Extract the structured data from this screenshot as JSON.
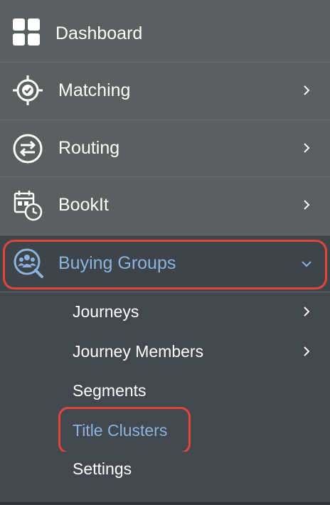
{
  "nav": {
    "items": [
      {
        "label": "Dashboard",
        "icon": "dashboard-grid-icon",
        "has_chevron": false
      },
      {
        "label": "Matching",
        "icon": "target-check-icon",
        "has_chevron": true
      },
      {
        "label": "Routing",
        "icon": "routing-arrows-icon",
        "has_chevron": true
      },
      {
        "label": "BookIt",
        "icon": "calendar-clock-icon",
        "has_chevron": true
      },
      {
        "label": "Buying Groups",
        "icon": "people-search-icon",
        "expanded": true
      }
    ],
    "buying_groups_children": [
      {
        "label": "Journeys",
        "has_chevron": true
      },
      {
        "label": "Journey Members",
        "has_chevron": true
      },
      {
        "label": "Segments",
        "has_chevron": false
      },
      {
        "label": "Title Clusters",
        "has_chevron": false,
        "active": true
      },
      {
        "label": "Settings",
        "has_chevron": false
      }
    ]
  },
  "colors": {
    "sidebar_bg": "#5b5f60",
    "submenu_bg": "#43484e",
    "active_text": "#8ab4e0",
    "highlight_outline": "#e0443a"
  }
}
